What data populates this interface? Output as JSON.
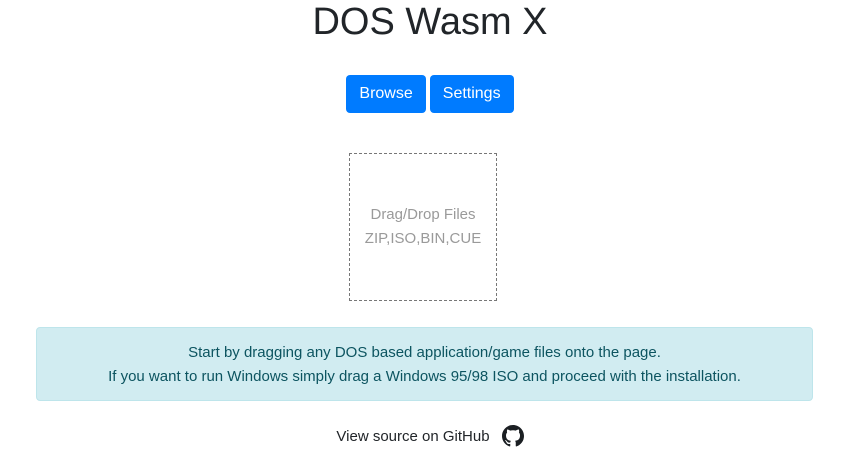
{
  "header": {
    "title": "DOS Wasm X"
  },
  "toolbar": {
    "browse_label": "Browse",
    "settings_label": "Settings"
  },
  "dropzone": {
    "line1": "Drag/Drop Files",
    "line2": "ZIP,ISO,BIN,CUE"
  },
  "info": {
    "line1": "Start by dragging any DOS based application/game files onto the page.",
    "line2": "If you want to run Windows simply drag a Windows 95/98 ISO and proceed with the installation."
  },
  "footer": {
    "link_text": "View source on GitHub",
    "icon": "github-icon"
  },
  "colors": {
    "primary": "#007bff",
    "info_bg": "#d1ecf1",
    "info_text": "#0c5460"
  }
}
